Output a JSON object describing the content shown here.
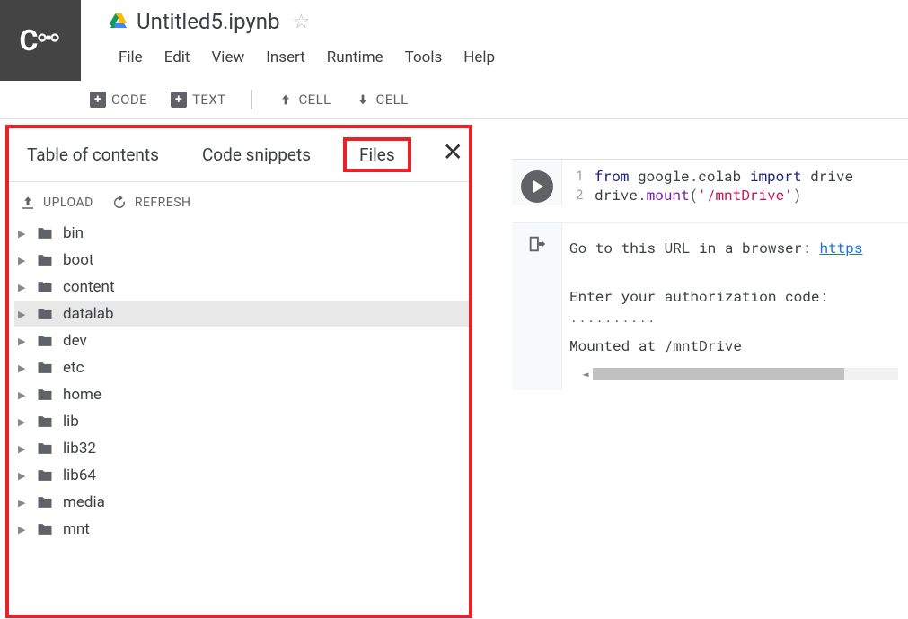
{
  "header": {
    "logo": "CO",
    "title": "Untitled5.ipynb"
  },
  "menubar": [
    "File",
    "Edit",
    "View",
    "Insert",
    "Runtime",
    "Tools",
    "Help"
  ],
  "toolbar": {
    "code": "CODE",
    "text": "TEXT",
    "cell_up": "CELL",
    "cell_down": "CELL"
  },
  "sidebar": {
    "tabs": {
      "toc": "Table of contents",
      "snippets": "Code snippets",
      "files": "Files"
    },
    "actions": {
      "upload": "UPLOAD",
      "refresh": "REFRESH"
    },
    "tree": [
      {
        "name": "bin",
        "selected": false
      },
      {
        "name": "boot",
        "selected": false
      },
      {
        "name": "content",
        "selected": false
      },
      {
        "name": "datalab",
        "selected": true
      },
      {
        "name": "dev",
        "selected": false
      },
      {
        "name": "etc",
        "selected": false
      },
      {
        "name": "home",
        "selected": false
      },
      {
        "name": "lib",
        "selected": false
      },
      {
        "name": "lib32",
        "selected": false
      },
      {
        "name": "lib64",
        "selected": false
      },
      {
        "name": "media",
        "selected": false
      },
      {
        "name": "mnt",
        "selected": false
      }
    ]
  },
  "code": {
    "line1": {
      "kw1": "from",
      "mod1": "google",
      "dot1": ".",
      "mod2": "colab",
      "kw2": "import",
      "mod3": "drive"
    },
    "line2": {
      "mod": "drive",
      "dot": ".",
      "fn": "mount",
      "lp": "(",
      "str": "'/mntDrive'",
      "rp": ")"
    }
  },
  "output": {
    "line1a": "Go to this URL in a browser: ",
    "line1b": "https",
    "line2": "",
    "line3": "Enter your authorization code:",
    "line4": "··········",
    "line5": "Mounted at /mntDrive"
  }
}
